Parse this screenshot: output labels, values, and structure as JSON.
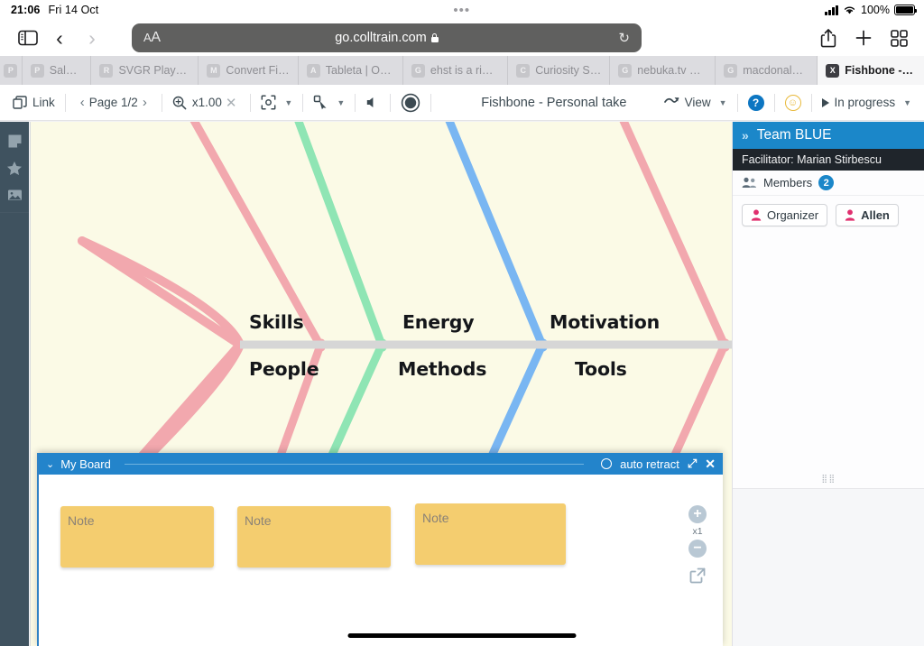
{
  "status_bar": {
    "time": "21:06",
    "date": "Fri 14 Oct",
    "battery_percent": "100%",
    "dots": "•••"
  },
  "browser": {
    "url": "go.colltrain.com",
    "aa_label": "A",
    "aa_label_big": "A",
    "reload_glyph": "↻",
    "back_glyph": "‹",
    "forward_glyph": "›",
    "share_icon": "share-icon",
    "new_tab_icon": "plus-icon",
    "tabs_overview_icon": "grid-icon",
    "sidebar_icon": "sidebar-icon",
    "tabs": [
      {
        "favicon": "P",
        "label": "",
        "active": false,
        "tiny": true
      },
      {
        "favicon": "P",
        "label": "SalesA",
        "active": false
      },
      {
        "favicon": "R",
        "label": "SVGR Playgr...",
        "active": false
      },
      {
        "favicon": "M",
        "label": "Convert Fig...",
        "active": false
      },
      {
        "favicon": "A",
        "label": "Tableta | Ofe...",
        "active": false
      },
      {
        "favicon": "G",
        "label": "ehst is a ring...",
        "active": false
      },
      {
        "favicon": "C",
        "label": "Curiosity Str...",
        "active": false
      },
      {
        "favicon": "G",
        "label": "nebuka.tv ap...",
        "active": false
      },
      {
        "favicon": "G",
        "label": "macdonalds...",
        "active": false
      },
      {
        "favicon": "X",
        "label": "Fishbone - P...",
        "active": true
      }
    ]
  },
  "app_toolbar": {
    "link_label": "Link",
    "page_label": "Page 1/2",
    "prev_glyph": "‹",
    "next_glyph": "›",
    "zoom_label": "x1.00",
    "zoom_close_glyph": "✕",
    "fit_icon": "fit-to-screen-icon",
    "pointer_icon": "pointer-tool-icon",
    "volume_icon": "volume-icon",
    "record_icon": "record-icon",
    "caret_glyph": "▼",
    "doc_title": "Fishbone - Personal take",
    "view_label": "View",
    "help_label": "?",
    "smiley_label": "☺",
    "status_label": "In progress"
  },
  "left_rail": {
    "items": [
      {
        "icon": "sticky-note-icon"
      },
      {
        "icon": "star-icon"
      },
      {
        "icon": "image-icon"
      }
    ]
  },
  "right_panel": {
    "team_title": "Team BLUE",
    "collapse_glyph": "»",
    "facilitator": "Facilitator: Marian Stirbescu",
    "members_label": "Members",
    "members_count": "2",
    "members": [
      {
        "name": "Organizer",
        "bold": false
      },
      {
        "name": "Allen",
        "bold": true
      }
    ],
    "accent_blue": "#1b87c9",
    "avatar_pink": "#e0306f"
  },
  "my_board": {
    "title": "My Board",
    "caret_glyph": "⌄",
    "auto_retract_label": "auto retract",
    "expand_glyph": "⤢",
    "close_glyph": "✕",
    "notes": [
      {
        "placeholder": "Note"
      },
      {
        "placeholder": "Note"
      },
      {
        "placeholder": "Note"
      }
    ],
    "zoom_in_glyph": "+",
    "zoom_level": "x1",
    "zoom_out_glyph": "−",
    "popout_icon": "external-link-icon"
  },
  "chart_data": {
    "type": "diagram",
    "diagram_type": "fishbone",
    "title": "Fishbone - Personal take",
    "canvas_color": "#fbfae6",
    "spine_color": "#d4d4d4",
    "head_color": "#f2a8ae",
    "categories_top": [
      "Skills",
      "Energy",
      "Motivation"
    ],
    "categories_bottom": [
      "People",
      "Methods",
      "Tools"
    ],
    "bone_colors": [
      "#f2a8ae",
      "#8fe5b4",
      "#79b6f2",
      "#f2a8ae"
    ],
    "bones": [
      {
        "label": "Skills",
        "side": "top",
        "color": "#f2a8ae"
      },
      {
        "label": "Energy",
        "side": "top",
        "color": "#8fe5b4"
      },
      {
        "label": "Motivation",
        "side": "top",
        "color": "#79b6f2"
      },
      {
        "label": "People",
        "side": "bottom",
        "color": "#8fe5b4"
      },
      {
        "label": "Methods",
        "side": "bottom",
        "color": "#79b6f2"
      },
      {
        "label": "Tools",
        "side": "bottom",
        "color": "#f2a8ae"
      }
    ]
  }
}
